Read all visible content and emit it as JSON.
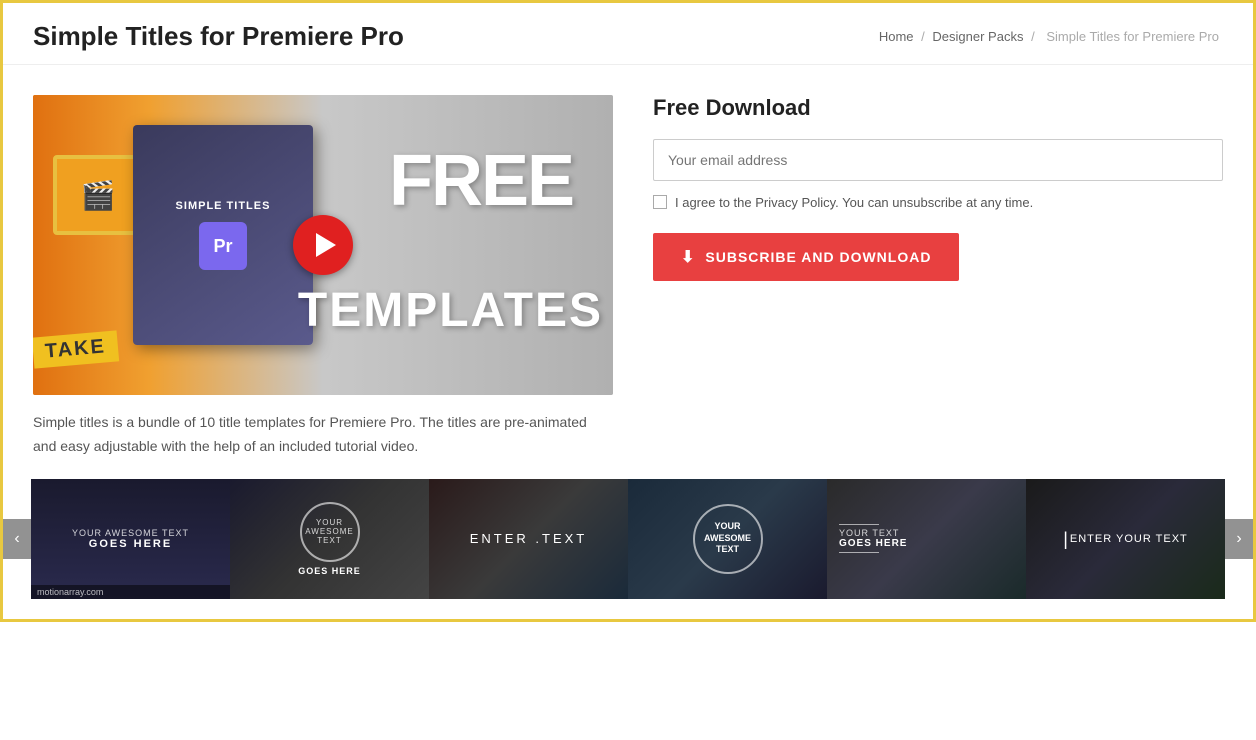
{
  "header": {
    "title": "Simple Titles for Premiere Pro",
    "breadcrumb": {
      "home": "Home",
      "separator1": "/",
      "designer_packs": "Designer Packs",
      "separator2": "/",
      "current": "Simple Titles for Premiere Pro"
    }
  },
  "main": {
    "video": {
      "label": "SIMPLE TITLES",
      "free_text": "FREE",
      "templates_text": "TEMPLATES",
      "take_text": "TAKE"
    },
    "description": "Simple titles is a bundle of 10 title templates for Premiere Pro. The titles are pre-animated and easy adjustable with the help of an included tutorial video.",
    "form": {
      "title": "Free Download",
      "email_placeholder": "Your email address",
      "privacy_text": "I agree to the Privacy Policy. You can unsubscribe at any time.",
      "subscribe_label": "SUBSCRIBE AND DOWNLOAD"
    }
  },
  "carousel": {
    "prev_label": "‹",
    "next_label": "›",
    "slides": [
      {
        "id": 1,
        "type": "text-overlay",
        "top_text": "YOUR AWESOME TEXT",
        "bottom_text": "GOES HERE",
        "watermark": "motionarray.com"
      },
      {
        "id": 2,
        "type": "circle",
        "top_text": "YOUR AWESOME TEXT",
        "bottom_text": "GOES HERE"
      },
      {
        "id": 3,
        "type": "simple",
        "text": "ENTER TEXT"
      },
      {
        "id": 4,
        "type": "circle-big",
        "line1": "YOUR",
        "line2": "AWESOME",
        "line3": "TEXT"
      },
      {
        "id": 5,
        "type": "lines",
        "top_text": "YOUR TEXT",
        "bottom_text": "GOES HERE"
      },
      {
        "id": 6,
        "type": "cursor",
        "text": "ENTER YOUR TEXT"
      }
    ]
  }
}
